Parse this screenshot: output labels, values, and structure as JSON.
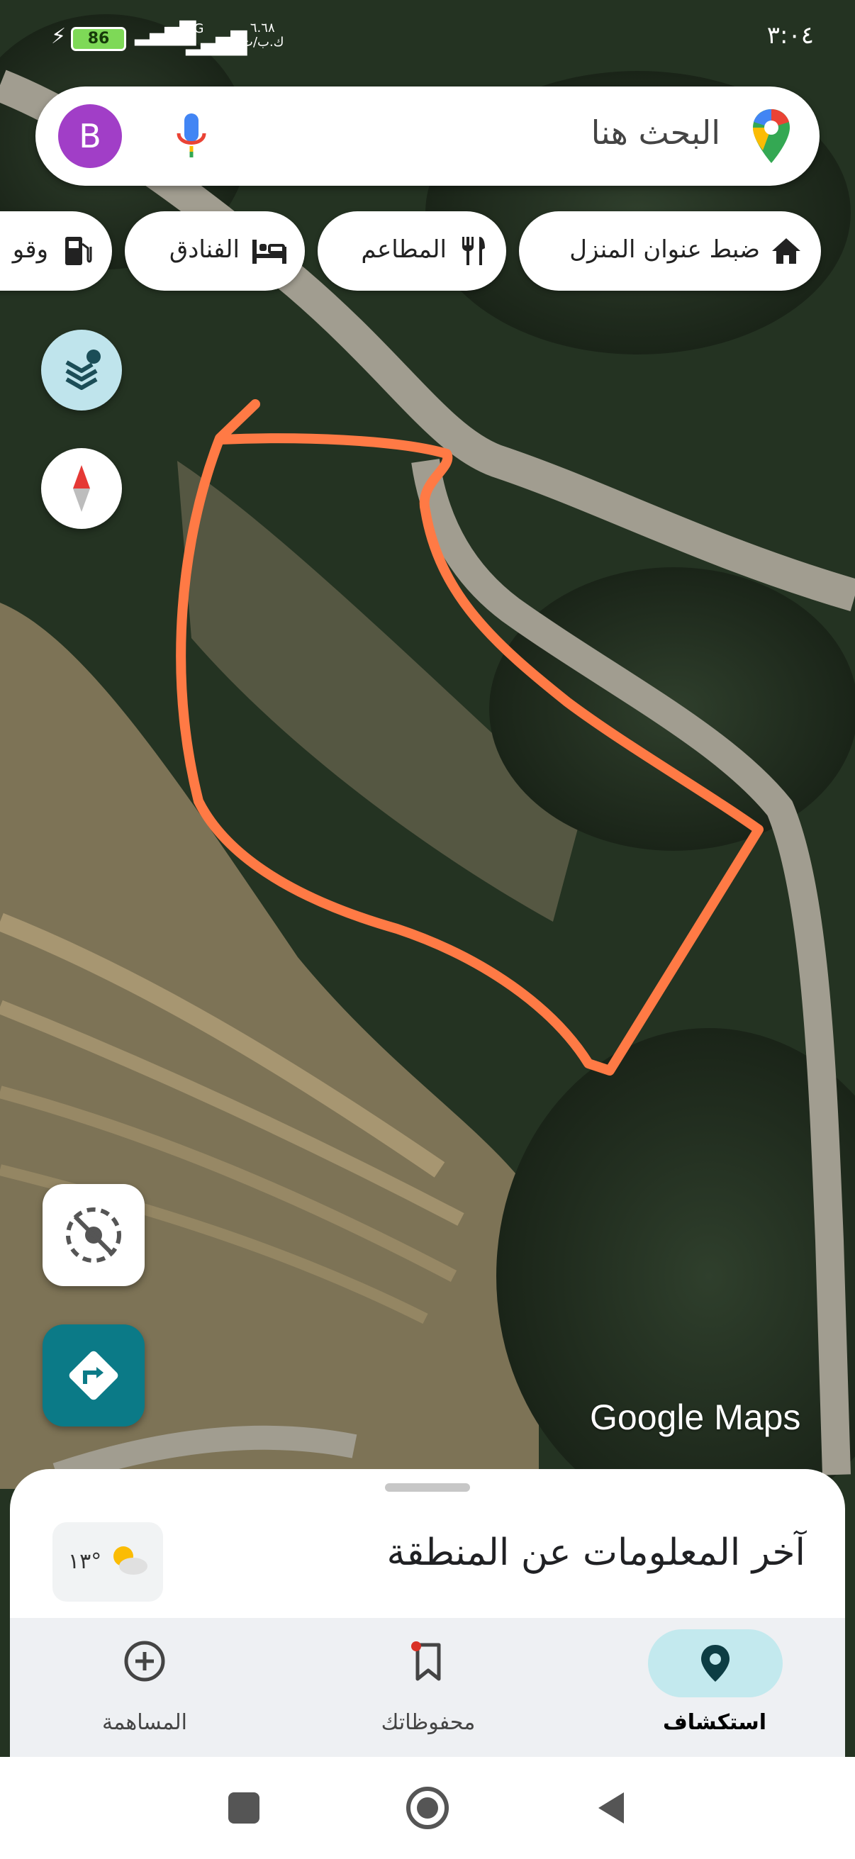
{
  "status_bar": {
    "time": "٣:٠٤",
    "battery_level": "86",
    "network": "4G",
    "speed_value": "٦.٦٨",
    "speed_unit": "ك.ب/ث"
  },
  "search": {
    "placeholder": "البحث هنا",
    "avatar_letter": "B"
  },
  "chips": [
    {
      "label": "ضبط عنوان المنزل",
      "icon": "home-icon"
    },
    {
      "label": "المطاعم",
      "icon": "restaurant-icon"
    },
    {
      "label": "الفنادق",
      "icon": "hotel-icon"
    },
    {
      "label": "وقو",
      "icon": "gas-station-icon"
    }
  ],
  "map": {
    "watermark": "Google Maps",
    "annotation_color": "#ff7a45"
  },
  "sheet": {
    "title": "آخر المعلومات عن المنطقة",
    "weather_temp": "١٣°"
  },
  "bottom_nav": [
    {
      "label": "استكشاف",
      "icon": "explore-pin-icon",
      "active": true
    },
    {
      "label": "محفوظاتك",
      "icon": "bookmark-icon",
      "active": false
    },
    {
      "label": "المساهمة",
      "icon": "add-circle-icon",
      "active": false
    }
  ],
  "colors": {
    "accent": "#0b7a87",
    "active_pill": "#c3e9ee",
    "avatar": "#a13ec7"
  }
}
